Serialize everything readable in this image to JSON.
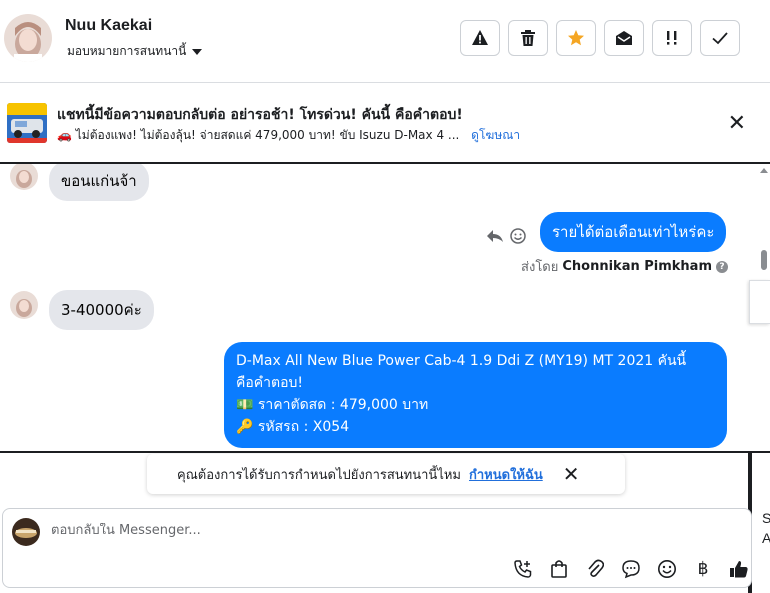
{
  "header": {
    "contact_name": "Nuu Kaekai",
    "assign_label": "มอบหมายการสนทนานี้",
    "actions": [
      {
        "name": "report-spam",
        "icon": "!"
      },
      {
        "name": "delete",
        "icon": "🗑"
      },
      {
        "name": "star",
        "icon": "★"
      },
      {
        "name": "mark-unread",
        "icon": "✉"
      },
      {
        "name": "follow-up",
        "icon": "!!"
      },
      {
        "name": "done",
        "icon": "✓"
      }
    ]
  },
  "ad": {
    "title": "แชทนี้มีข้อความตอบกลับต่อ อย่ารอช้า! โทรด่วน! คันนี้ คือคำตอบ!",
    "description": "🚗 ไม่ต้องแพง! ไม่ต้องลุ้น! จ่ายสดแค่ 479,000 บาท! ขับ Isuzu D-Max 4 ...",
    "link": "ดูโฆษณา",
    "close_icon": "✕"
  },
  "messages": [
    {
      "direction": "in",
      "text": "ขอนแก่นจ้า"
    },
    {
      "direction": "out",
      "text": "รายได้ต่อเดือนเท่าไหร่คะ"
    },
    {
      "direction": "in",
      "text": "3-40000ค่ะ"
    },
    {
      "direction": "out",
      "lines": [
        "D-Max All New Blue Power Cab-4 1.9 Ddi Z (MY19) MT 2021 คันนี้",
        "คือคำตอบ!",
        "💵 ราคาตัดสด : 479,000 บาท",
        "🔑 รหัสรถ : X054"
      ]
    }
  ],
  "sent_by": {
    "prefix": "ส่งโดย",
    "name": "Chonnikan Pimkham",
    "help": "?"
  },
  "suggestion": {
    "text": "คุณต้องการได้รับการกำหนดไปยังการสนทนานี้ไหม",
    "link": "กำหนดให้ฉัน",
    "close_icon": "✕"
  },
  "composer": {
    "placeholder": "ตอบกลับใน Messenger...",
    "tools": [
      "call-plus",
      "shopping-bag",
      "paperclip",
      "speech-bubble",
      "smiley",
      "baht",
      "thumbs-up"
    ],
    "baht_symbol": "฿"
  },
  "right_peek": {
    "line1": "S",
    "line2": "A"
  }
}
